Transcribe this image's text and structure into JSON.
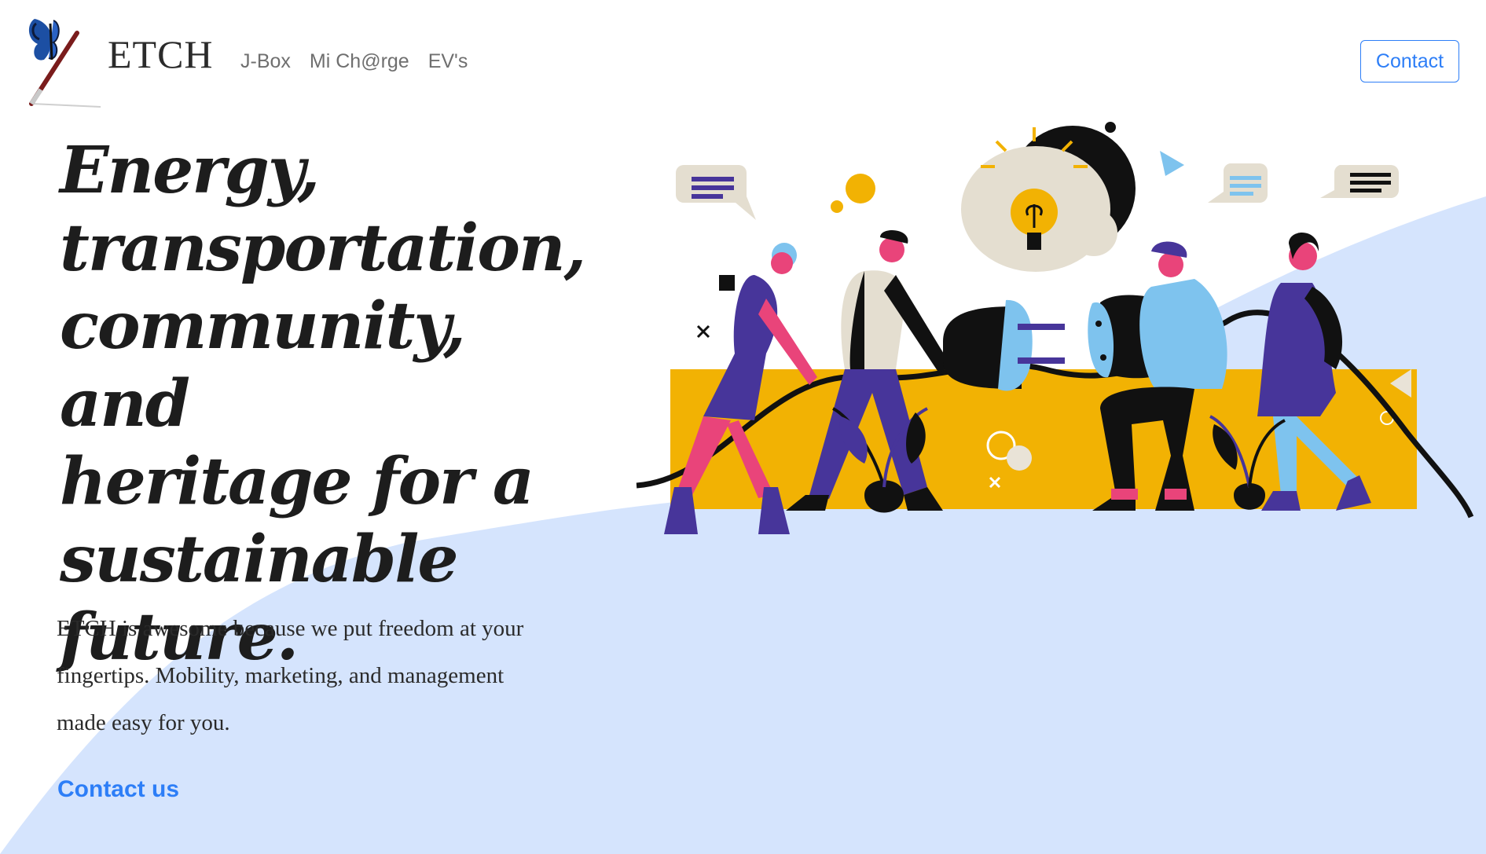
{
  "header": {
    "brand": "ETCH",
    "nav": [
      "J-Box",
      "Mi Ch@rge",
      "EV's"
    ],
    "contact_label": "Contact"
  },
  "hero": {
    "headline_lines": [
      "Energy,",
      "transportation,",
      "community, and",
      "heritage for a",
      "sustainable",
      "future."
    ],
    "description_lines": [
      "ETCH is awesome because we put freedom at your",
      "fingertips. Mobility, marketing, and management",
      "made easy for you."
    ],
    "cta_label": "Contact us"
  },
  "icons": [
    "butterfly-paintbrush-logo",
    "lightbulb-icon",
    "plug-icon",
    "socket-icon",
    "speech-bubble-icon",
    "plant-icon"
  ],
  "colors": {
    "accent": "#2d7ef7",
    "background_wave": "#d5e4fd",
    "illustration_yellow": "#f2b203",
    "illustration_purple": "#47359a",
    "illustration_pink": "#e9447a",
    "illustration_lightblue": "#7ec3ee"
  }
}
